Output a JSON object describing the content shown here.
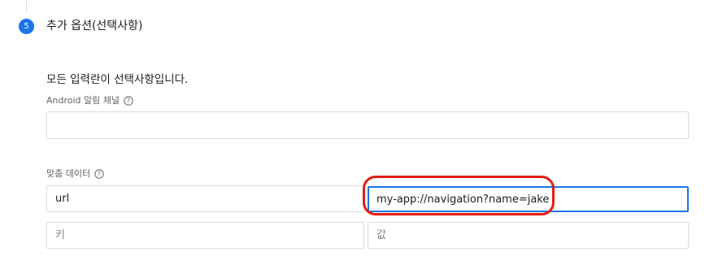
{
  "step": {
    "number": "5",
    "title": "추가 옵션(선택사항)"
  },
  "description": "모든 입력란이 선택사항입니다.",
  "android_channel": {
    "label": "Android 알림 채널",
    "value": ""
  },
  "custom_data": {
    "label": "맞춤 데이터",
    "rows": [
      {
        "key": "url",
        "value": "my-app://navigation?name=jake"
      }
    ],
    "new_row": {
      "key_placeholder": "키",
      "value_placeholder": "값"
    }
  },
  "colors": {
    "accent": "#1a73e8",
    "annotation": "#e51c12"
  },
  "icons": {
    "help": "help-circle-icon"
  }
}
